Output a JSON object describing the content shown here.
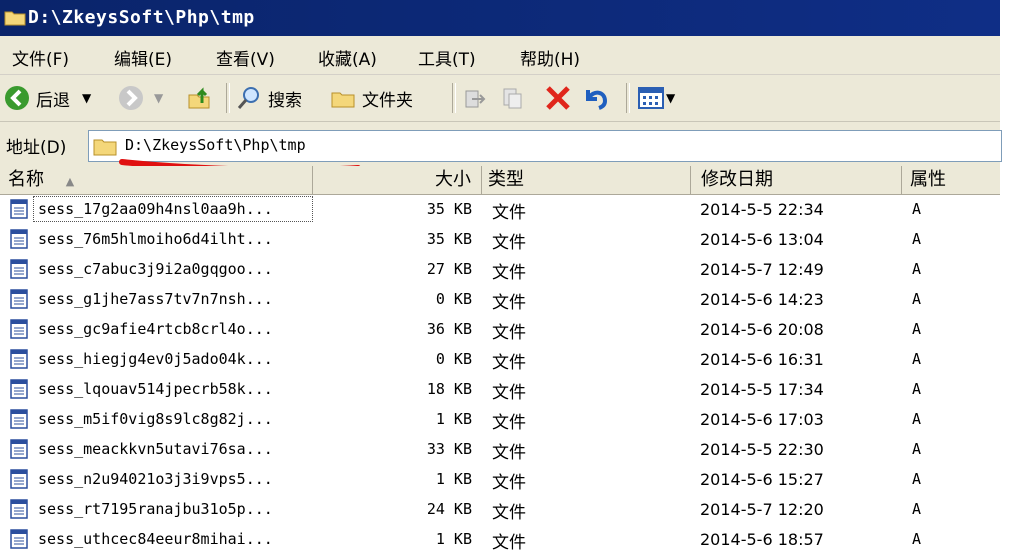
{
  "window": {
    "title": "D:\\ZkeysSoft\\Php\\tmp"
  },
  "menu": [
    "文件(F)",
    "编辑(E)",
    "查看(V)",
    "收藏(A)",
    "工具(T)",
    "帮助(H)"
  ],
  "toolbar": {
    "back": "后退",
    "search": "搜索",
    "folders": "文件夹"
  },
  "address": {
    "label": "地址(D)",
    "value": "D:\\ZkeysSoft\\Php\\tmp"
  },
  "columns": {
    "name": "名称",
    "size": "大小",
    "type": "类型",
    "modified": "修改日期",
    "attr": "属性"
  },
  "files": [
    {
      "name": "sess_17g2aa09h4nsl0aa9h...",
      "size": "35 KB",
      "type": "文件",
      "modified": "2014-5-5 22:34",
      "attr": "A"
    },
    {
      "name": "sess_76m5hlmoiho6d4ilht...",
      "size": "35 KB",
      "type": "文件",
      "modified": "2014-5-6 13:04",
      "attr": "A"
    },
    {
      "name": "sess_c7abuc3j9i2a0gqgoo...",
      "size": "27 KB",
      "type": "文件",
      "modified": "2014-5-7 12:49",
      "attr": "A"
    },
    {
      "name": "sess_g1jhe7ass7tv7n7nsh...",
      "size": "0 KB",
      "type": "文件",
      "modified": "2014-5-6 14:23",
      "attr": "A"
    },
    {
      "name": "sess_gc9afie4rtcb8crl4o...",
      "size": "36 KB",
      "type": "文件",
      "modified": "2014-5-6 20:08",
      "attr": "A"
    },
    {
      "name": "sess_hiegjg4ev0j5ado04k...",
      "size": "0 KB",
      "type": "文件",
      "modified": "2014-5-6 16:31",
      "attr": "A"
    },
    {
      "name": "sess_lqouav514jpecrb58k...",
      "size": "18 KB",
      "type": "文件",
      "modified": "2014-5-5 17:34",
      "attr": "A"
    },
    {
      "name": "sess_m5if0vig8s9lc8g82j...",
      "size": "1 KB",
      "type": "文件",
      "modified": "2014-5-6 17:03",
      "attr": "A"
    },
    {
      "name": "sess_meackkvn5utavi76sa...",
      "size": "33 KB",
      "type": "文件",
      "modified": "2014-5-5 22:30",
      "attr": "A"
    },
    {
      "name": "sess_n2u94021o3j3i9vps5...",
      "size": "1 KB",
      "type": "文件",
      "modified": "2014-5-6 15:27",
      "attr": "A"
    },
    {
      "name": "sess_rt7195ranajbu31o5p...",
      "size": "24 KB",
      "type": "文件",
      "modified": "2014-5-7 12:20",
      "attr": "A"
    },
    {
      "name": "sess_uthcec84eeur8mihai...",
      "size": "1 KB",
      "type": "文件",
      "modified": "2014-5-6 18:57",
      "attr": "A"
    }
  ]
}
